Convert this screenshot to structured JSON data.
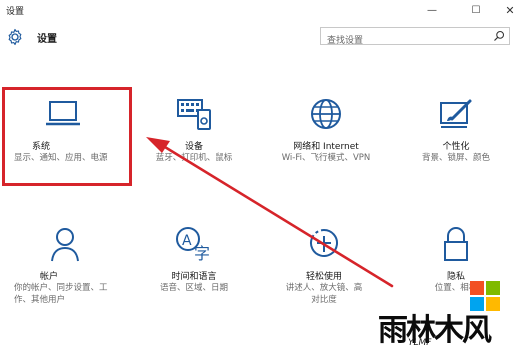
{
  "window": {
    "title": "设置",
    "minimize": "—",
    "maximize": "☐",
    "close": "✕"
  },
  "header": {
    "title": "设置",
    "search_placeholder": "查找设置"
  },
  "tiles": [
    {
      "name": "系统",
      "desc": "显示、通知、应用、电源",
      "icon": "laptop-icon"
    },
    {
      "name": "设备",
      "desc": "蓝牙、打印机、鼠标",
      "icon": "keyboard-device-icon"
    },
    {
      "name": "网络和 Internet",
      "desc": "Wi-Fi、飞行模式、VPN",
      "icon": "globe-icon"
    },
    {
      "name": "个性化",
      "desc": "背景、锁屏、颜色",
      "icon": "paint-icon"
    },
    {
      "name": "帐户",
      "desc": "你的帐户、同步设置、工作、其他用户",
      "icon": "person-icon"
    },
    {
      "name": "时间和语言",
      "desc": "语音、区域、日期",
      "icon": "time-language-icon"
    },
    {
      "name": "轻松使用",
      "desc": "讲述人、放大镜、高对比度",
      "icon": "ease-of-access-icon"
    },
    {
      "name": "隐私",
      "desc": "位置、相机",
      "icon": "lock-icon"
    }
  ],
  "watermark": {
    "brand": "雨林木风",
    "sub": "YLMF"
  },
  "colors": {
    "highlight": "#d6242a",
    "icon": "#1f5a9e"
  }
}
